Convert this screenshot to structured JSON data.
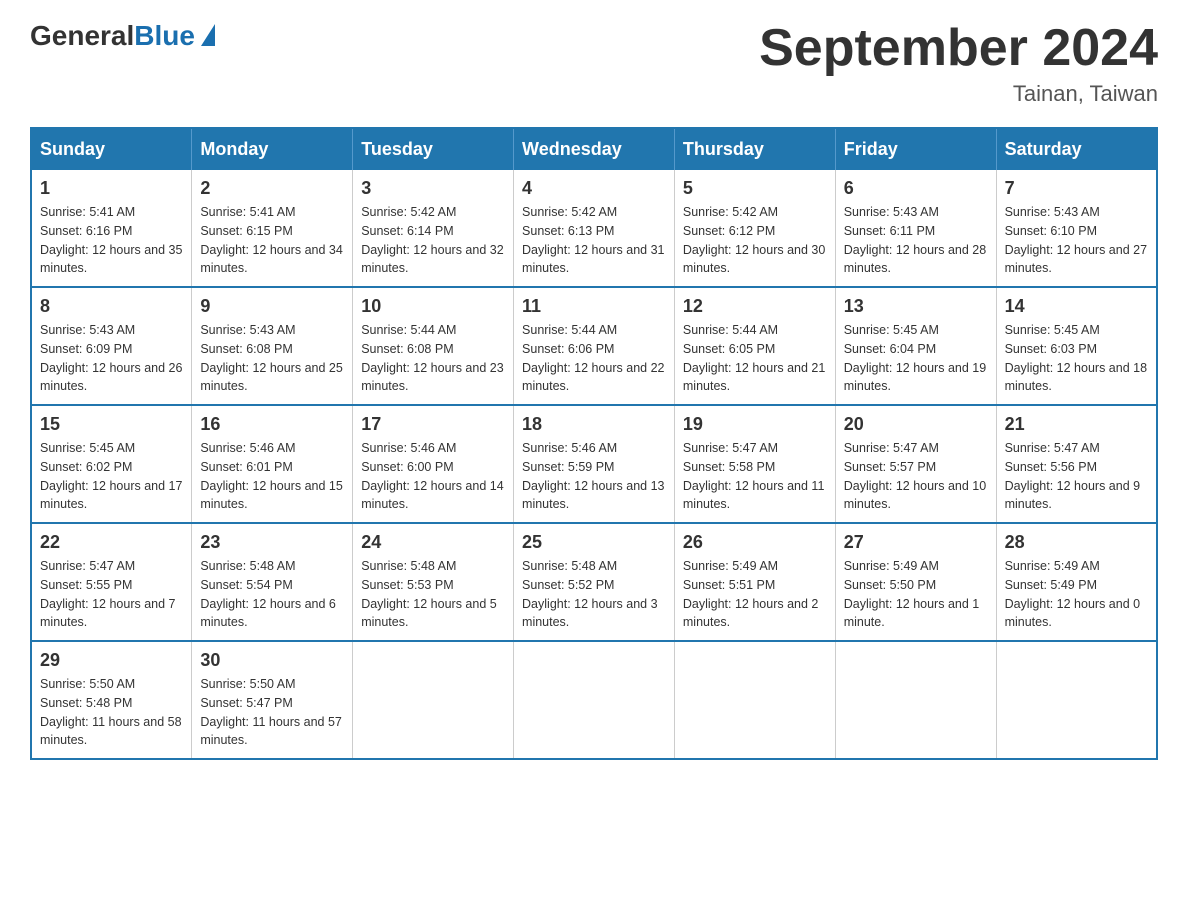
{
  "logo": {
    "general": "General",
    "blue": "Blue"
  },
  "title": "September 2024",
  "subtitle": "Tainan, Taiwan",
  "days_header": [
    "Sunday",
    "Monday",
    "Tuesday",
    "Wednesday",
    "Thursday",
    "Friday",
    "Saturday"
  ],
  "weeks": [
    [
      {
        "day": "1",
        "sunrise": "5:41 AM",
        "sunset": "6:16 PM",
        "daylight": "12 hours and 35 minutes."
      },
      {
        "day": "2",
        "sunrise": "5:41 AM",
        "sunset": "6:15 PM",
        "daylight": "12 hours and 34 minutes."
      },
      {
        "day": "3",
        "sunrise": "5:42 AM",
        "sunset": "6:14 PM",
        "daylight": "12 hours and 32 minutes."
      },
      {
        "day": "4",
        "sunrise": "5:42 AM",
        "sunset": "6:13 PM",
        "daylight": "12 hours and 31 minutes."
      },
      {
        "day": "5",
        "sunrise": "5:42 AM",
        "sunset": "6:12 PM",
        "daylight": "12 hours and 30 minutes."
      },
      {
        "day": "6",
        "sunrise": "5:43 AM",
        "sunset": "6:11 PM",
        "daylight": "12 hours and 28 minutes."
      },
      {
        "day": "7",
        "sunrise": "5:43 AM",
        "sunset": "6:10 PM",
        "daylight": "12 hours and 27 minutes."
      }
    ],
    [
      {
        "day": "8",
        "sunrise": "5:43 AM",
        "sunset": "6:09 PM",
        "daylight": "12 hours and 26 minutes."
      },
      {
        "day": "9",
        "sunrise": "5:43 AM",
        "sunset": "6:08 PM",
        "daylight": "12 hours and 25 minutes."
      },
      {
        "day": "10",
        "sunrise": "5:44 AM",
        "sunset": "6:08 PM",
        "daylight": "12 hours and 23 minutes."
      },
      {
        "day": "11",
        "sunrise": "5:44 AM",
        "sunset": "6:06 PM",
        "daylight": "12 hours and 22 minutes."
      },
      {
        "day": "12",
        "sunrise": "5:44 AM",
        "sunset": "6:05 PM",
        "daylight": "12 hours and 21 minutes."
      },
      {
        "day": "13",
        "sunrise": "5:45 AM",
        "sunset": "6:04 PM",
        "daylight": "12 hours and 19 minutes."
      },
      {
        "day": "14",
        "sunrise": "5:45 AM",
        "sunset": "6:03 PM",
        "daylight": "12 hours and 18 minutes."
      }
    ],
    [
      {
        "day": "15",
        "sunrise": "5:45 AM",
        "sunset": "6:02 PM",
        "daylight": "12 hours and 17 minutes."
      },
      {
        "day": "16",
        "sunrise": "5:46 AM",
        "sunset": "6:01 PM",
        "daylight": "12 hours and 15 minutes."
      },
      {
        "day": "17",
        "sunrise": "5:46 AM",
        "sunset": "6:00 PM",
        "daylight": "12 hours and 14 minutes."
      },
      {
        "day": "18",
        "sunrise": "5:46 AM",
        "sunset": "5:59 PM",
        "daylight": "12 hours and 13 minutes."
      },
      {
        "day": "19",
        "sunrise": "5:47 AM",
        "sunset": "5:58 PM",
        "daylight": "12 hours and 11 minutes."
      },
      {
        "day": "20",
        "sunrise": "5:47 AM",
        "sunset": "5:57 PM",
        "daylight": "12 hours and 10 minutes."
      },
      {
        "day": "21",
        "sunrise": "5:47 AM",
        "sunset": "5:56 PM",
        "daylight": "12 hours and 9 minutes."
      }
    ],
    [
      {
        "day": "22",
        "sunrise": "5:47 AM",
        "sunset": "5:55 PM",
        "daylight": "12 hours and 7 minutes."
      },
      {
        "day": "23",
        "sunrise": "5:48 AM",
        "sunset": "5:54 PM",
        "daylight": "12 hours and 6 minutes."
      },
      {
        "day": "24",
        "sunrise": "5:48 AM",
        "sunset": "5:53 PM",
        "daylight": "12 hours and 5 minutes."
      },
      {
        "day": "25",
        "sunrise": "5:48 AM",
        "sunset": "5:52 PM",
        "daylight": "12 hours and 3 minutes."
      },
      {
        "day": "26",
        "sunrise": "5:49 AM",
        "sunset": "5:51 PM",
        "daylight": "12 hours and 2 minutes."
      },
      {
        "day": "27",
        "sunrise": "5:49 AM",
        "sunset": "5:50 PM",
        "daylight": "12 hours and 1 minute."
      },
      {
        "day": "28",
        "sunrise": "5:49 AM",
        "sunset": "5:49 PM",
        "daylight": "12 hours and 0 minutes."
      }
    ],
    [
      {
        "day": "29",
        "sunrise": "5:50 AM",
        "sunset": "5:48 PM",
        "daylight": "11 hours and 58 minutes."
      },
      {
        "day": "30",
        "sunrise": "5:50 AM",
        "sunset": "5:47 PM",
        "daylight": "11 hours and 57 minutes."
      },
      null,
      null,
      null,
      null,
      null
    ]
  ]
}
